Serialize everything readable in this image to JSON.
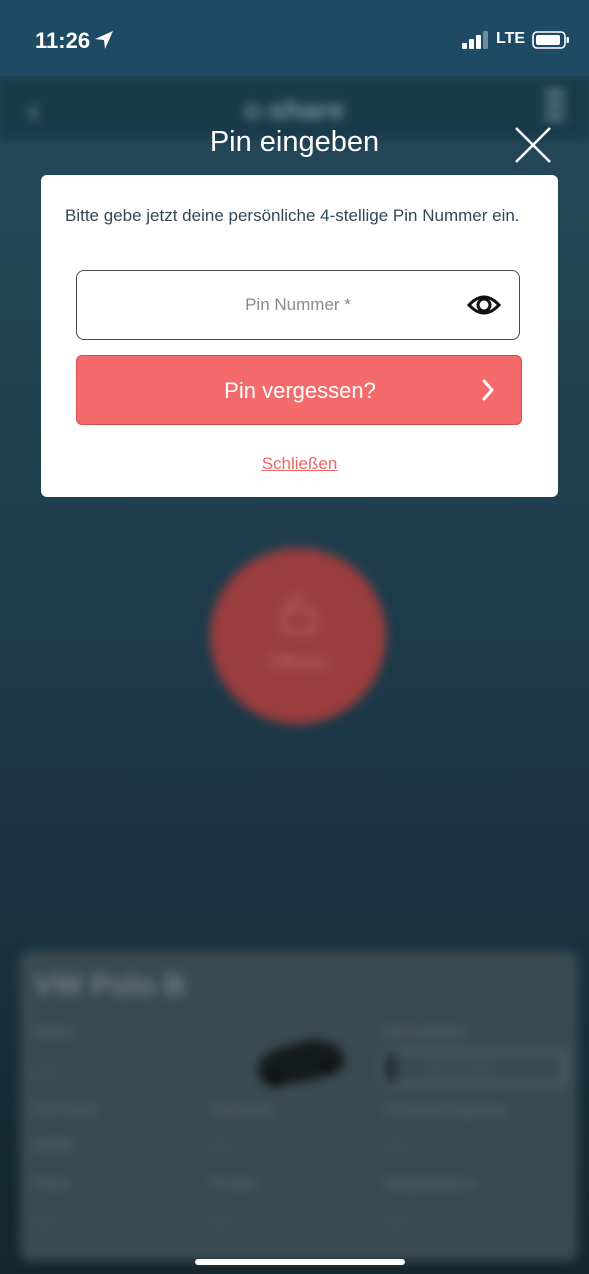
{
  "status_bar": {
    "time": "11:26",
    "network": "LTE"
  },
  "app_bar": {
    "title": "c-share"
  },
  "background": {
    "open_button_label": "Öffnen",
    "vehicle": {
      "name": "VW Polo B",
      "status_label": "Status",
      "status_value": "- / -",
      "km_label": "KM-Stand",
      "km_value": "14020",
      "tank_label": "Tankinhalt",
      "tank_value": "- / -",
      "door_label": "Türen",
      "door_value": "- / -",
      "window_label": "Fenster",
      "window_value": "- / -",
      "plate_label": "Kennzeichen",
      "plate_value": "WN M 208",
      "immobilizer_label": "Zentralverriegelung",
      "immobilizer_value": "- / -",
      "ignition_label": "Wegfahrsperre",
      "ignition_value": "- / -"
    }
  },
  "dialog": {
    "title": "Pin eingeben",
    "instruction": "Bitte gebe jetzt deine persönliche 4-stellige Pin Nummer ein.",
    "pin_input": {
      "placeholder": "Pin Nummer *",
      "value": ""
    },
    "forgot_button_label": "Pin vergessen?",
    "close_link": "Schließen"
  },
  "colors": {
    "accent": "#f56b6b",
    "status_bar": "#1e4b63",
    "text_dark": "#2f4956"
  },
  "icons": [
    "location-arrow-icon",
    "signal-icon",
    "battery-icon",
    "back-icon",
    "menu-icon",
    "lock-open-icon",
    "car-icon",
    "close-icon",
    "eye-icon",
    "chevron-right-icon"
  ]
}
